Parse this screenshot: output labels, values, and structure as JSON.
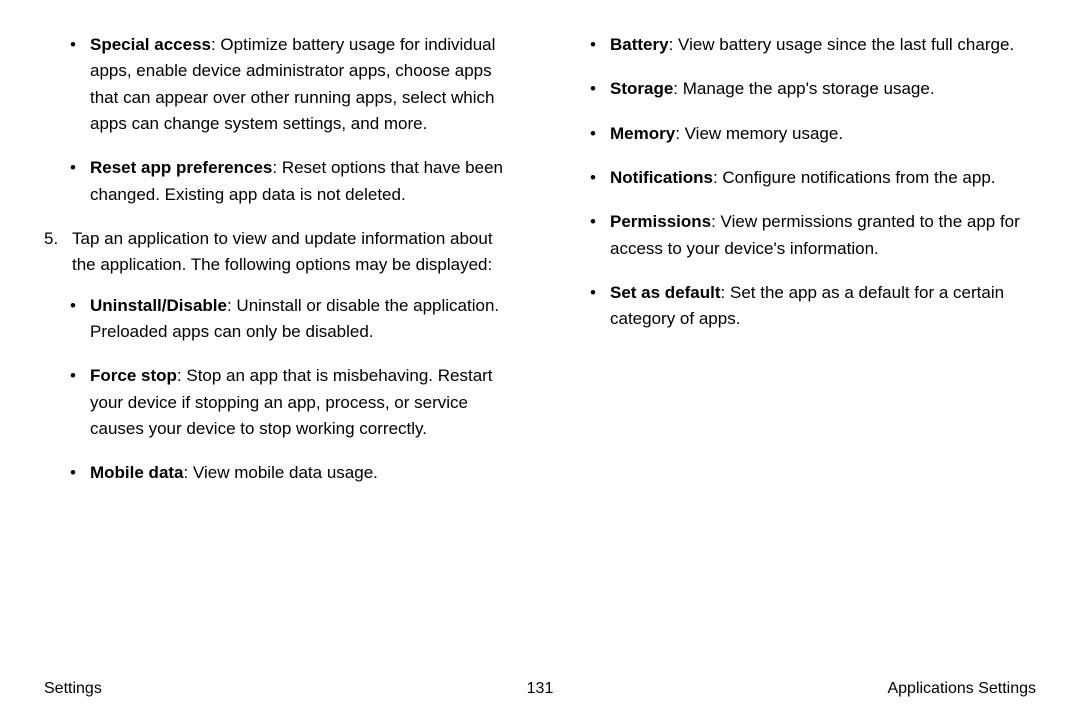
{
  "left": {
    "top_bullets": [
      {
        "lead": "Special access",
        "desc": ": Optimize battery usage for individual apps, enable device administrator apps, choose apps that can appear over other running apps, select which apps can change system settings, and more."
      },
      {
        "lead": "Reset app preferences",
        "desc": ": Reset options that have been changed. Existing app data is not deleted."
      }
    ],
    "step_number": "5.",
    "step_text": "Tap an application to view and update information about the application. The following options may be displayed:",
    "sub_bullets": [
      {
        "lead": "Uninstall/Disable",
        "desc": ": Uninstall or disable the application. Preloaded apps can only be disabled."
      },
      {
        "lead": "Force stop",
        "desc": ": Stop an app that is misbehaving. Restart your device if stopping an app, process, or service causes your device to stop working correctly."
      },
      {
        "lead": "Mobile data",
        "desc": ": View mobile data usage."
      }
    ]
  },
  "right": {
    "bullets": [
      {
        "lead": "Battery",
        "desc": ": View battery usage since the last full charge."
      },
      {
        "lead": "Storage",
        "desc": ": Manage the app's storage usage."
      },
      {
        "lead": "Memory",
        "desc": ": View memory usage."
      },
      {
        "lead": "Notifications",
        "desc": ": Configure notifications from the app."
      },
      {
        "lead": "Permissions",
        "desc": ": View permissions granted to the app for access to your device's information."
      },
      {
        "lead": "Set as default",
        "desc": ": Set the app as a default for a certain category of apps."
      }
    ]
  },
  "footer": {
    "left": "Settings",
    "center": "131",
    "right": "Applications Settings"
  }
}
